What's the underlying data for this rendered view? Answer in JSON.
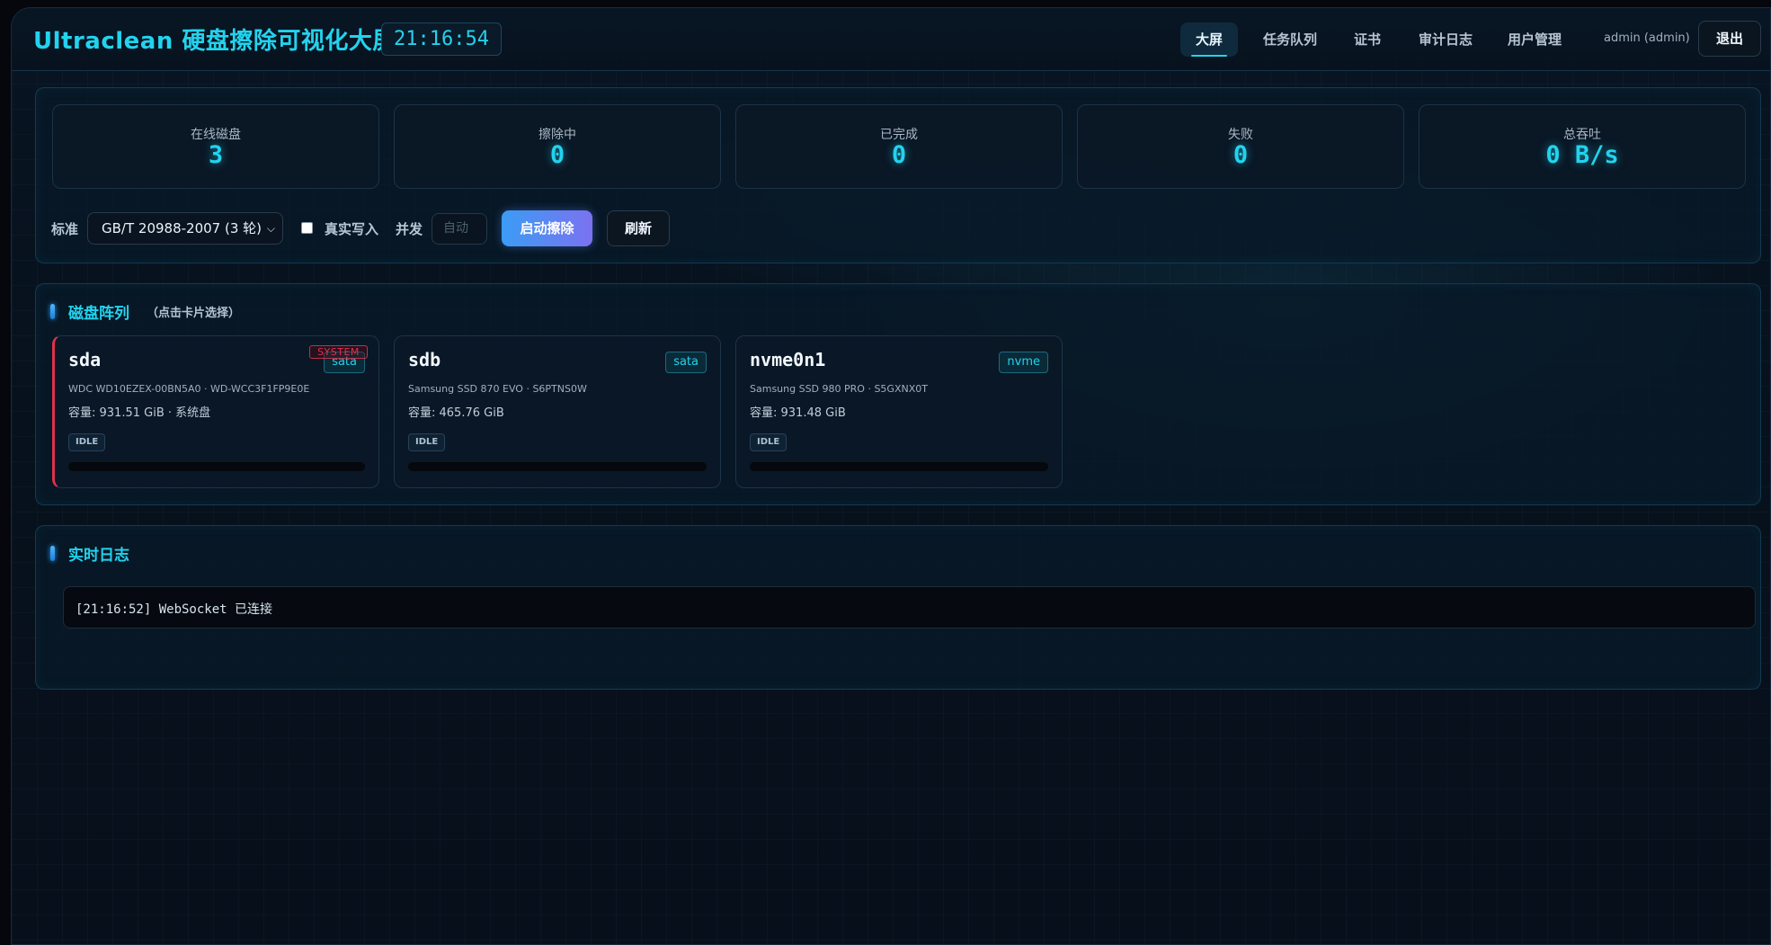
{
  "header": {
    "brand": "Ultraclean 硬盘擦除可视化大屏",
    "clock": "21:16:54",
    "nav": [
      {
        "label": "大屏",
        "active": true
      },
      {
        "label": "任务队列",
        "active": false
      },
      {
        "label": "证书",
        "active": false
      },
      {
        "label": "审计日志",
        "active": false
      },
      {
        "label": "用户管理",
        "active": false
      }
    ],
    "user": "admin (admin)",
    "logout_label": "退出"
  },
  "stats": [
    {
      "label": "在线磁盘",
      "value": "3"
    },
    {
      "label": "擦除中",
      "value": "0"
    },
    {
      "label": "已完成",
      "value": "0"
    },
    {
      "label": "失败",
      "value": "0"
    },
    {
      "label": "总吞吐",
      "value": "0 B/s"
    }
  ],
  "controls": {
    "standard_label": "标准",
    "standard_value": "GB/T 20988-2007 (3 轮)",
    "real_write_label": "真实写入",
    "real_write_checked": false,
    "concurrency_label": "并发",
    "concurrency_placeholder": "自动",
    "start_label": "启动擦除",
    "refresh_label": "刷新"
  },
  "disk_section": {
    "title": "磁盘阵列",
    "hint": "（点击卡片选择）",
    "disks": [
      {
        "name": "sda",
        "bus": "sata",
        "system_tag": "SYSTEM",
        "model": "WDC WD10EZEX-00BN5A0 · WD-WCC3F1FP9E0E",
        "capacity": "容量: 931.51 GiB · 系统盘",
        "state": "IDLE",
        "progress": 0
      },
      {
        "name": "sdb",
        "bus": "sata",
        "model": "Samsung SSD 870 EVO · S6PTNS0W",
        "capacity": "容量: 465.76 GiB",
        "state": "IDLE",
        "progress": 0
      },
      {
        "name": "nvme0n1",
        "bus": "nvme",
        "model": "Samsung SSD 980 PRO · S5GXNX0T",
        "capacity": "容量: 931.48 GiB",
        "state": "IDLE",
        "progress": 0
      }
    ]
  },
  "log_section": {
    "title": "实时日志",
    "lines": [
      "[21:16:52] WebSocket 已连接"
    ]
  },
  "colors": {
    "accent": "#22d3ee",
    "system_red": "#e0314c",
    "start_gradient_from": "#3b9cf5",
    "start_gradient_to": "#7b72f0"
  }
}
